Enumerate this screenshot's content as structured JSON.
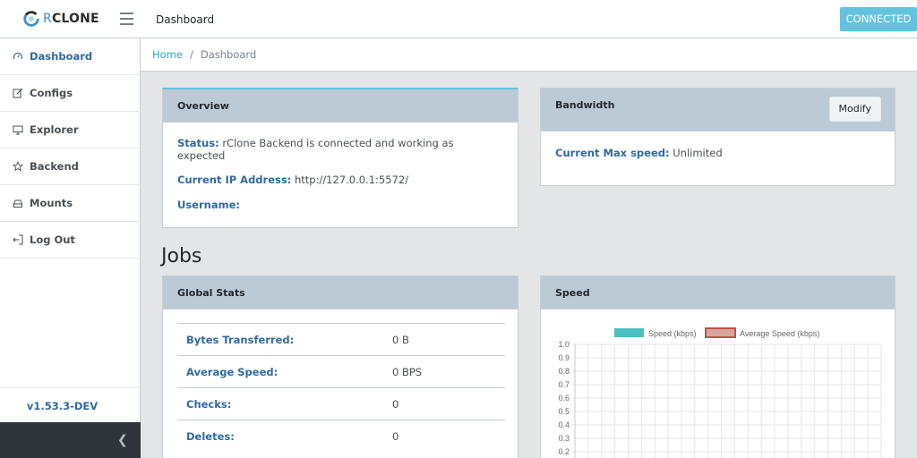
{
  "header": {
    "logo_prefix": "R",
    "logo_text": "CLONE",
    "title": "Dashboard",
    "status_button": "CONNECTED",
    "accent_color": "#63c2de"
  },
  "sidebar": {
    "items": [
      {
        "label": "Dashboard",
        "icon": "speedometer-icon",
        "active": true
      },
      {
        "label": "Configs",
        "icon": "edit-icon",
        "active": false
      },
      {
        "label": "Explorer",
        "icon": "monitor-icon",
        "active": false
      },
      {
        "label": "Backend",
        "icon": "star-icon",
        "active": false
      },
      {
        "label": "Mounts",
        "icon": "drive-icon",
        "active": false
      },
      {
        "label": "Log Out",
        "icon": "logout-icon",
        "active": false
      }
    ],
    "version": "v1.53.3-DEV",
    "collapse_icon": "chevron-left-icon"
  },
  "breadcrumb": {
    "home": "Home",
    "separator": "/",
    "current": "Dashboard"
  },
  "overview": {
    "title": "Overview",
    "status_label": "Status:",
    "status_value": "rClone Backend is connected and working as expected",
    "ip_label": "Current IP Address:",
    "ip_value": "http://127.0.0.1:5572/",
    "username_label": "Username:",
    "username_value": ""
  },
  "bandwidth": {
    "title": "Bandwidth",
    "modify_button": "Modify",
    "max_speed_label": "Current Max speed:",
    "max_speed_value": "Unlimited"
  },
  "jobs": {
    "heading": "Jobs"
  },
  "global_stats": {
    "title": "Global Stats",
    "rows": [
      {
        "label": "Bytes Transferred:",
        "value": "0 B"
      },
      {
        "label": "Average Speed:",
        "value": "0 BPS"
      },
      {
        "label": "Checks:",
        "value": "0"
      },
      {
        "label": "Deletes:",
        "value": "0"
      }
    ]
  },
  "speed": {
    "title": "Speed"
  },
  "chart_data": {
    "type": "line",
    "title": "",
    "xlabel": "",
    "ylabel": "",
    "ylim": [
      0,
      1
    ],
    "y_ticks": [
      "1.0",
      "0.9",
      "0.8",
      "0.7",
      "0.6",
      "0.5",
      "0.4",
      "0.3",
      "0.2"
    ],
    "grid": true,
    "legend_position": "top",
    "series": [
      {
        "name": "Speed (kbps)",
        "color": "#4bc0c0",
        "values": []
      },
      {
        "name": "Average Speed (kbps)",
        "color": "#d9a59a",
        "border": "#c0504d",
        "values": []
      }
    ]
  }
}
